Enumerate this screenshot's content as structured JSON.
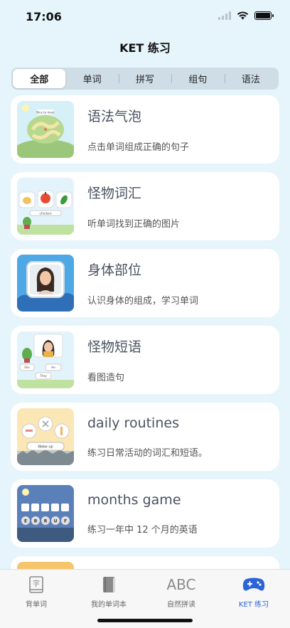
{
  "status_bar": {
    "time": "17:06"
  },
  "nav": {
    "title": "KET 练习"
  },
  "segments": [
    {
      "label": "全部",
      "active": true
    },
    {
      "label": "单词",
      "active": false
    },
    {
      "label": "拼写",
      "active": false
    },
    {
      "label": "组句",
      "active": false
    },
    {
      "label": "语法",
      "active": false
    }
  ],
  "cards": [
    {
      "title": "语法气泡",
      "subtitle": "点击单词组成正确的句子",
      "thumb_label": "Nice to meet"
    },
    {
      "title": "怪物词汇",
      "subtitle": "听单词找到正确的图片",
      "thumb_label": "chicken"
    },
    {
      "title": "身体部位",
      "subtitle": "认识身体的组成，学习单词"
    },
    {
      "title": "怪物短语",
      "subtitle": "看图造句",
      "thumb_labels": [
        "She",
        "He",
        "They"
      ]
    },
    {
      "title": "daily routines",
      "subtitle": "练习日常活动的词汇和短语。",
      "thumb_label": "Wake up"
    },
    {
      "title": "months game",
      "subtitle": "练习一年中 12 个月的英语",
      "thumb_letters": [
        "E",
        "B",
        "R",
        "U",
        "F"
      ]
    }
  ],
  "tabbar": [
    {
      "label": "背单词",
      "icon": "book-char-icon",
      "active": false,
      "glyph": "字"
    },
    {
      "label": "我的单词本",
      "icon": "notebook-icon",
      "active": false
    },
    {
      "label": "自然拼读",
      "icon": "abc-icon",
      "active": false,
      "glyph": "ABC"
    },
    {
      "label": "KET 练习",
      "icon": "gamepad-icon",
      "active": true
    }
  ],
  "colors": {
    "accent": "#2b63d9",
    "background": "#e6f4fb"
  }
}
